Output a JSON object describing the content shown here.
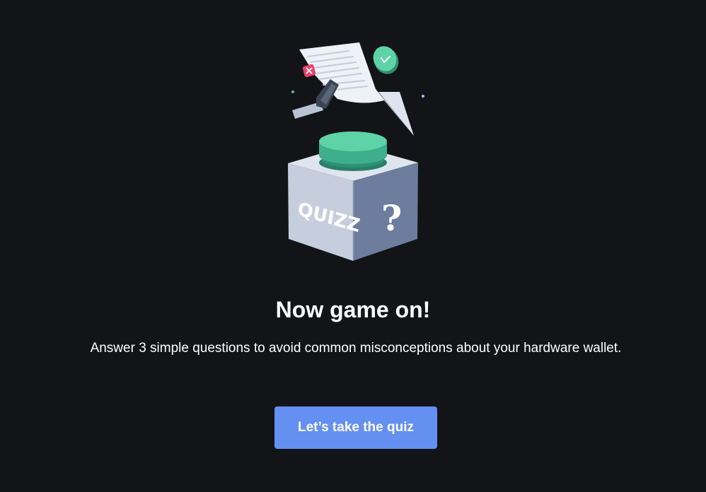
{
  "illustration": {
    "box_front_text": "QUIZZ",
    "box_side_text": "?",
    "icons": [
      "cross-badge-icon",
      "check-badge-icon",
      "hardware-wallet-icon",
      "paper-sheet-icon",
      "quiz-box-icon",
      "push-button-icon"
    ],
    "colors": {
      "accent_green": "#4cc49b",
      "accent_red": "#e8426a",
      "box_front": "#c8d0df",
      "box_side": "#6e7e9f",
      "paper": "#eef1f7"
    }
  },
  "content": {
    "title": "Now game on!",
    "description": "Answer 3 simple questions to avoid common misconceptions about your hardware wallet."
  },
  "actions": {
    "start_quiz_label": "Let’s take the quiz"
  },
  "colors": {
    "background": "#131417",
    "button": "#6490f1",
    "text": "#ffffff"
  }
}
